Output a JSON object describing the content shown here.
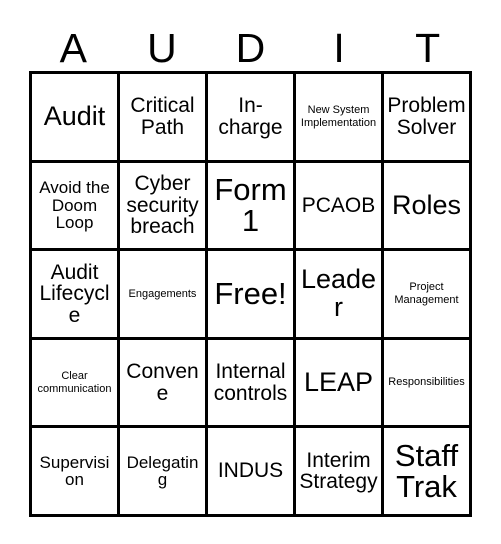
{
  "card": {
    "title_letters": [
      "A",
      "U",
      "D",
      "I",
      "T"
    ],
    "free_space_label": "Free!",
    "rows": [
      [
        {
          "label": "Audit",
          "size": "lg"
        },
        {
          "label": "Critical\nPath",
          "size": "md"
        },
        {
          "label": "In-\ncharge",
          "size": "md"
        },
        {
          "label": "New System\nImplementation",
          "size": "xs"
        },
        {
          "label": "Problem\nSolver",
          "size": "md"
        }
      ],
      [
        {
          "label": "Avoid the\nDoom\nLoop",
          "size": "sm"
        },
        {
          "label": "Cyber\nsecurity\nbreach",
          "size": "md"
        },
        {
          "label": "Form\n1",
          "size": "xl"
        },
        {
          "label": "PCAOB",
          "size": "md"
        },
        {
          "label": "Roles",
          "size": "lg"
        }
      ],
      [
        {
          "label": "Audit\nLifecycle",
          "size": "md"
        },
        {
          "label": "Engagements",
          "size": "xs"
        },
        {
          "label": "Free!",
          "size": "xl"
        },
        {
          "label": "Leader",
          "size": "lg"
        },
        {
          "label": "Project\nManagement",
          "size": "xs"
        }
      ],
      [
        {
          "label": "Clear\ncommunication",
          "size": "xs"
        },
        {
          "label": "Convene",
          "size": "md"
        },
        {
          "label": "Internal\ncontrols",
          "size": "md"
        },
        {
          "label": "LEAP",
          "size": "lg"
        },
        {
          "label": "Responsibilities",
          "size": "xs"
        }
      ],
      [
        {
          "label": "Supervision",
          "size": "sm"
        },
        {
          "label": "Delegating",
          "size": "sm"
        },
        {
          "label": "INDUS",
          "size": "md"
        },
        {
          "label": "Interim\nStrategy",
          "size": "md"
        },
        {
          "label": "Staff\nTrak",
          "size": "xl"
        }
      ]
    ]
  },
  "colors": {
    "background": "#ffffff",
    "text": "#000000",
    "border": "#000000"
  }
}
